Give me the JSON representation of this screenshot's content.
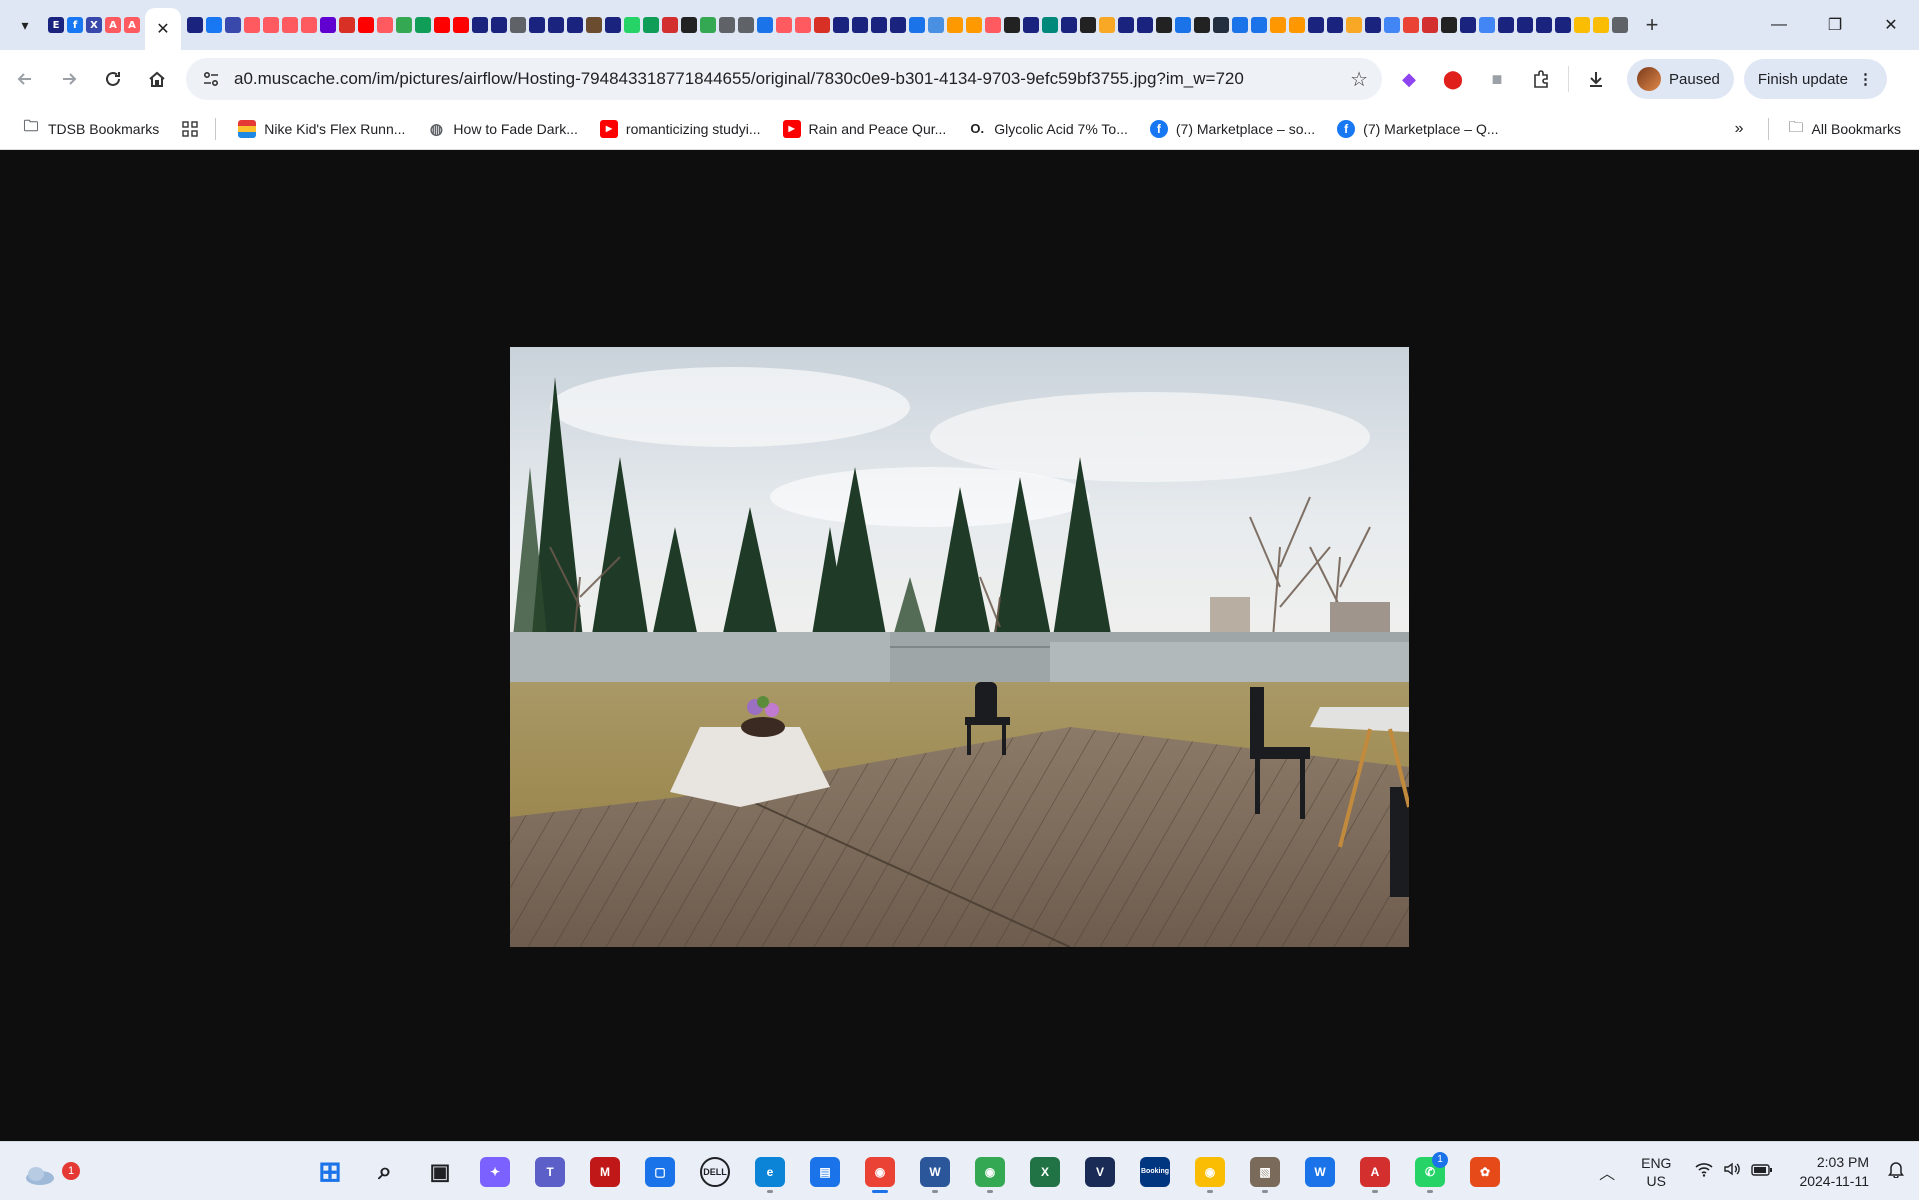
{
  "browser": {
    "active_tab_close": "✕",
    "new_tab": "+",
    "window": {
      "minimize": "—",
      "restore": "❐",
      "close": "✕"
    },
    "url": "a0.muscache.com/im/pictures/airflow/Hosting-794843318771844655/original/7830c0e9-b301-4134-9703-9efc59bf3755.jpg?im_w=720",
    "profile_label": "Paused",
    "update_label": "Finish update",
    "tab_favicons": [
      "#1a237e",
      "#1877f2",
      "#3949ab",
      "#ff5a5f",
      "#ff5a5f",
      "#ff5a5f",
      "#ff5a5f",
      "#6001d2",
      "#d93025",
      "#ff0000",
      "#ff5a5f",
      "#34a853",
      "#0f9d58",
      "#ff0000",
      "#ff0000",
      "#1a237e",
      "#1a237e",
      "#5f6368",
      "#1a237e",
      "#1a237e",
      "#1a237e",
      "#6b4c2e",
      "#1a237e",
      "#25d366",
      "#0f9d58",
      "#d32f2f",
      "#222222",
      "#34a853",
      "#5f6368",
      "#5f6368",
      "#1a73e8",
      "#ff5a5f",
      "#ff5a5f",
      "#d93025",
      "#1a237e",
      "#1a237e",
      "#1a237e",
      "#1a237e",
      "#1a73e8",
      "#4a90e2",
      "#ff9900",
      "#ff9900",
      "#ff5a5f",
      "#222222",
      "#1a237e",
      "#00897b",
      "#1a237e",
      "#222222",
      "#f9a825",
      "#1a237e",
      "#1a237e",
      "#222222",
      "#1a73e8",
      "#222222",
      "#232f3e",
      "#1a73e8",
      "#1a73e8",
      "#ff9800",
      "#ff9800",
      "#1a237e",
      "#1a237e",
      "#f9a825",
      "#1a237e",
      "#4285f4",
      "#ea4335",
      "#d32f2f",
      "#222222",
      "#1a237e",
      "#4285f4",
      "#1a237e",
      "#1a237e",
      "#1a237e",
      "#1a237e",
      "#fbbc04",
      "#fbbc04",
      "#5f6368"
    ]
  },
  "bookmarks": {
    "items": [
      {
        "label": "TDSB Bookmarks",
        "icon": "folder-star-icon",
        "color": "#5f6368"
      },
      {
        "label": "",
        "icon": "apps-grid-icon",
        "color": "#5f6368"
      },
      {
        "label": "Nike Kid's Flex Runn...",
        "icon": "nike-stripes-icon",
        "color": "#e53935"
      },
      {
        "label": "How to Fade Dark...",
        "icon": "globe-icon",
        "color": "#5f6368"
      },
      {
        "label": "romanticizing studyi...",
        "icon": "youtube-icon",
        "color": "#ff0000"
      },
      {
        "label": "Rain and Peace Qur...",
        "icon": "youtube-icon",
        "color": "#ff0000"
      },
      {
        "label": "Glycolic Acid 7% To...",
        "icon": "ordinary-icon",
        "color": "#222222"
      },
      {
        "label": "(7) Marketplace – so...",
        "icon": "facebook-icon",
        "color": "#1877f2"
      },
      {
        "label": "(7) Marketplace – Q...",
        "icon": "facebook-icon",
        "color": "#1877f2"
      }
    ],
    "more": "»",
    "all_label": "All Bookmarks"
  },
  "taskbar": {
    "weather_badge": "1",
    "apps": [
      {
        "name": "start-button",
        "color": "#1a73e8",
        "glyph": "⊞",
        "active": false,
        "running": false
      },
      {
        "name": "search-button",
        "color": "#202124",
        "glyph": "⌕",
        "active": false,
        "running": false
      },
      {
        "name": "task-view-button",
        "color": "#202124",
        "glyph": "▣",
        "active": false,
        "running": false
      },
      {
        "name": "copilot-app",
        "color": "#7b61ff",
        "glyph": "✦",
        "active": false,
        "running": false
      },
      {
        "name": "teams-app",
        "color": "#5b5fc7",
        "glyph": "T",
        "active": false,
        "running": false
      },
      {
        "name": "mcafee-app",
        "color": "#c01818",
        "glyph": "M",
        "active": false,
        "running": false
      },
      {
        "name": "dell-support-app",
        "color": "#1a73e8",
        "glyph": "▢",
        "active": false,
        "running": false
      },
      {
        "name": "dell-app",
        "color": "#202124",
        "glyph": "DELL",
        "active": false,
        "running": false
      },
      {
        "name": "edge-app",
        "color": "#0b84d8",
        "glyph": "e",
        "active": false,
        "running": true
      },
      {
        "name": "store-app",
        "color": "#1a73e8",
        "glyph": "▤",
        "active": false,
        "running": false
      },
      {
        "name": "chrome-app",
        "color": "#ea4335",
        "glyph": "◉",
        "active": true,
        "running": true
      },
      {
        "name": "word-app",
        "color": "#2b579a",
        "glyph": "W",
        "active": false,
        "running": true
      },
      {
        "name": "chrome-profile-app",
        "color": "#34a853",
        "glyph": "◉",
        "active": false,
        "running": true
      },
      {
        "name": "excel-app",
        "color": "#217346",
        "glyph": "X",
        "active": false,
        "running": false
      },
      {
        "name": "vpn-app",
        "color": "#1a2b55",
        "glyph": "V",
        "active": false,
        "running": false
      },
      {
        "name": "booking-app",
        "color": "#003580",
        "glyph": "Booking",
        "active": false,
        "running": false
      },
      {
        "name": "chrome-alt-app",
        "color": "#fbbc04",
        "glyph": "◉",
        "active": false,
        "running": true
      },
      {
        "name": "gallery-app",
        "color": "#7a6a5a",
        "glyph": "▧",
        "active": false,
        "running": true
      },
      {
        "name": "wordpress-app",
        "color": "#1a73e8",
        "glyph": "W",
        "active": false,
        "running": false
      },
      {
        "name": "acrobat-app",
        "color": "#d32f2f",
        "glyph": "A",
        "active": false,
        "running": true
      },
      {
        "name": "whatsapp-app",
        "color": "#25d366",
        "glyph": "✆",
        "active": false,
        "running": true,
        "badge": "1"
      },
      {
        "name": "photos-app",
        "color": "#e64a19",
        "glyph": "✿",
        "active": false,
        "running": false
      }
    ],
    "language": "ENG",
    "region": "US",
    "time": "2:03 PM",
    "date": "2024-11-11"
  }
}
